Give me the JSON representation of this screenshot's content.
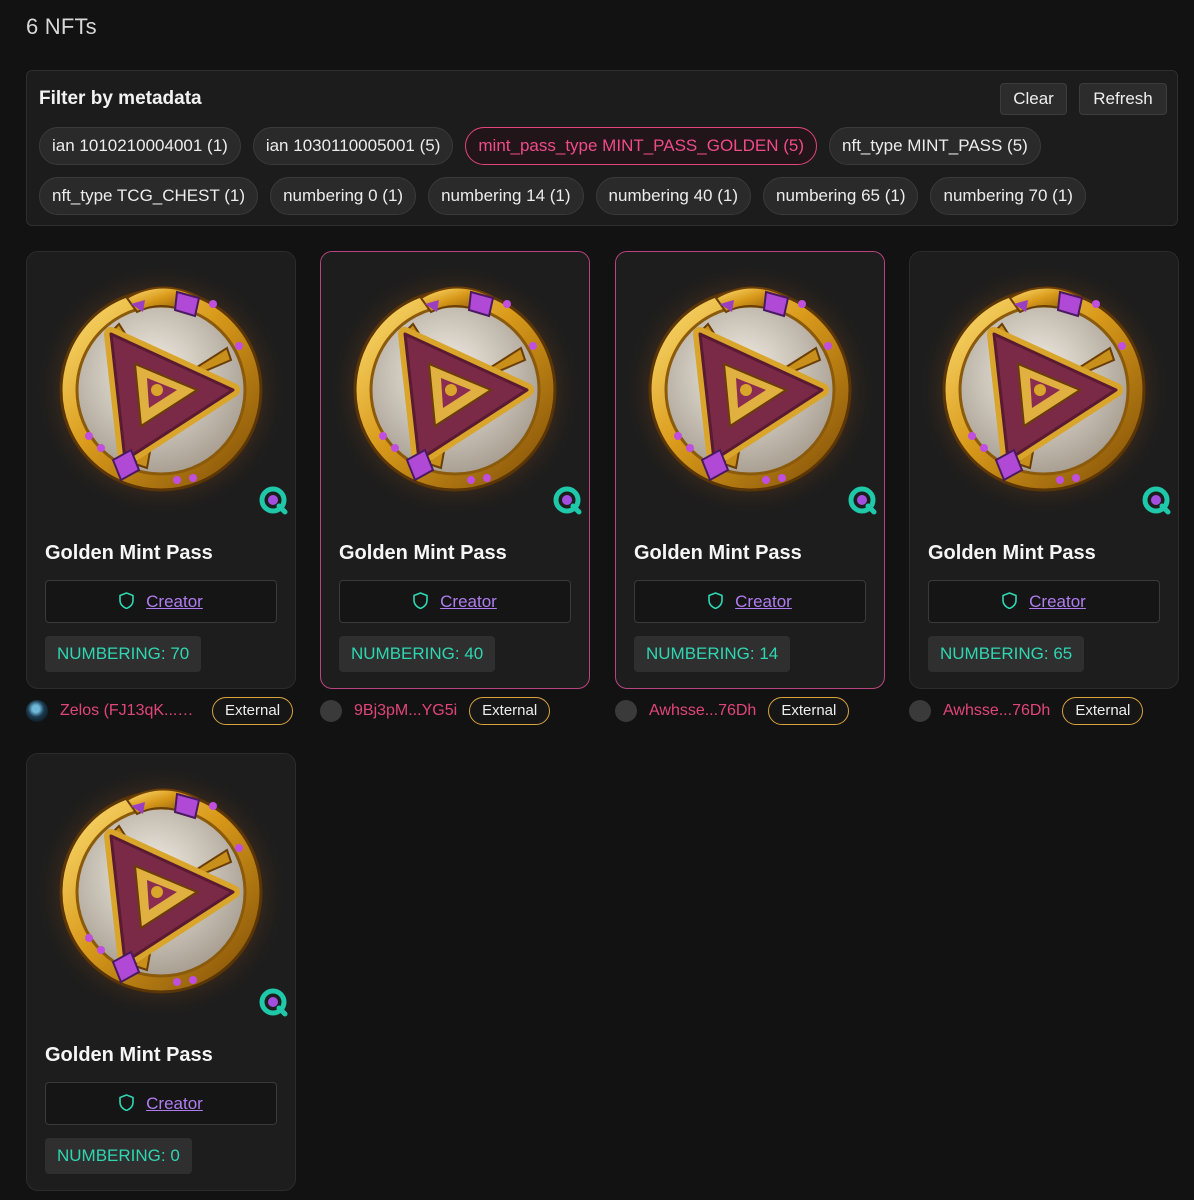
{
  "results": {
    "count_label": "6 NFTs"
  },
  "filter": {
    "title": "Filter by metadata",
    "clear_label": "Clear",
    "refresh_label": "Refresh",
    "chips_row1": [
      {
        "label": "ian 1010210004001 (1)",
        "active": false
      },
      {
        "label": "ian 1030110005001 (5)",
        "active": false
      },
      {
        "label": "mint_pass_type MINT_PASS_GOLDEN (5)",
        "active": true
      },
      {
        "label": "nft_type MINT_PASS (5)",
        "active": false
      }
    ],
    "chips_row2": [
      {
        "label": "nft_type TCG_CHEST (1)",
        "active": false
      },
      {
        "label": "numbering 0 (1)",
        "active": false
      },
      {
        "label": "numbering 14 (1)",
        "active": false
      },
      {
        "label": "numbering 40 (1)",
        "active": false
      },
      {
        "label": "numbering 65 (1)",
        "active": false
      },
      {
        "label": "numbering 70 (1)",
        "active": false
      }
    ]
  },
  "cards": [
    {
      "title": "Golden Mint Pass",
      "creator_label": "Creator",
      "numbering": "NUMBERING: 70",
      "owner": "Zelos (FJ13qK...A...",
      "external_label": "External"
    },
    {
      "title": "Golden Mint Pass",
      "creator_label": "Creator",
      "numbering": "NUMBERING: 40",
      "owner": "9Bj3pM...YG5i",
      "external_label": "External"
    },
    {
      "title": "Golden Mint Pass",
      "creator_label": "Creator",
      "numbering": "NUMBERING: 14",
      "owner": "Awhsse...76Dh",
      "external_label": "External"
    },
    {
      "title": "Golden Mint Pass",
      "creator_label": "Creator",
      "numbering": "NUMBERING: 65",
      "owner": "Awhsse...76Dh",
      "external_label": "External"
    },
    {
      "title": "Golden Mint Pass",
      "creator_label": "Creator",
      "numbering": "NUMBERING: 0",
      "owner": "",
      "external_label": ""
    }
  ],
  "icons": {
    "marketplace_badge": "magic-eden-q-icon",
    "creator": "shield-icon"
  },
  "colors": {
    "accent_pink": "#e2457a",
    "numbering_teal": "#2fd6b2",
    "creator_link_purple": "#b07df0",
    "external_border_gold": "#d9a43c",
    "badge_teal": "#1fc8a8"
  }
}
